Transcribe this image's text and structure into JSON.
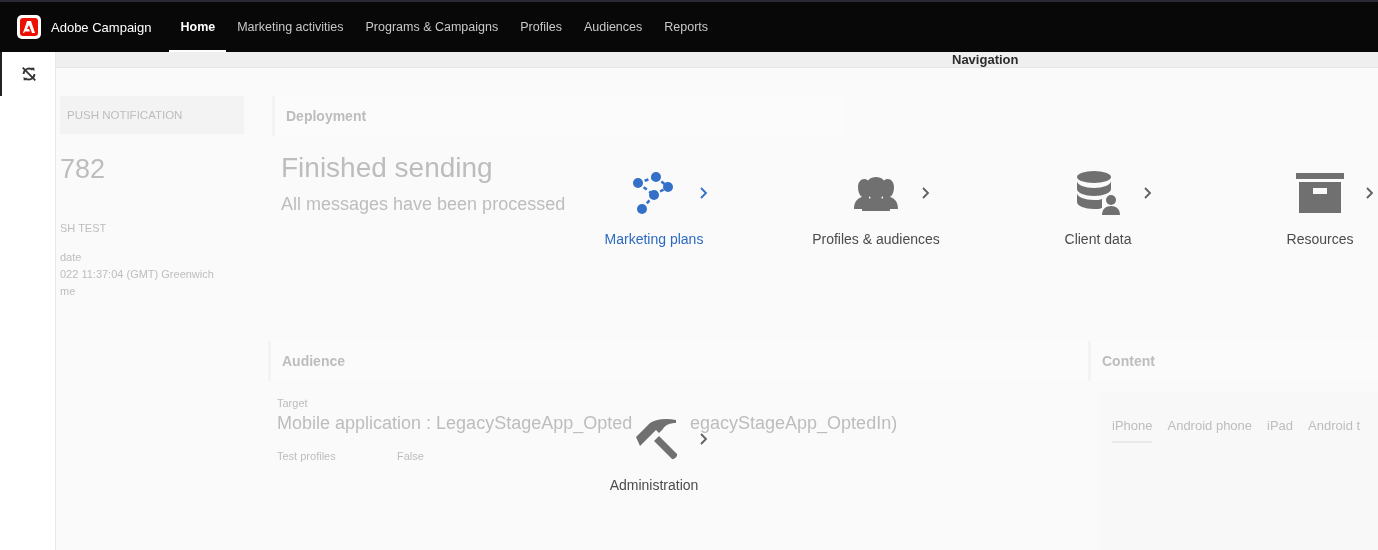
{
  "app": {
    "name": "Adobe Campaign"
  },
  "nav_tabs": [
    {
      "label": "Home",
      "selected": true
    },
    {
      "label": "Marketing activities",
      "selected": false
    },
    {
      "label": "Programs & Campaigns",
      "selected": false
    },
    {
      "label": "Profiles",
      "selected": false
    },
    {
      "label": "Audiences",
      "selected": false
    },
    {
      "label": "Reports",
      "selected": false
    }
  ],
  "background": {
    "left": {
      "badge": "PUSH NOTIFICATION",
      "number": "782",
      "name": "SH TEST",
      "date_label": "date",
      "date_lines": [
        "022 11:37:04 (GMT) Greenwich",
        "me"
      ]
    },
    "deployment": {
      "title": "Deployment",
      "status": "Finished sending",
      "detail": "All messages have been processed"
    },
    "audience": {
      "title": "Audience",
      "target_label": "Target",
      "target": [
        "Mobile application : LegacyStageApp_Opted",
        "egacyStageApp_OptedIn)"
      ],
      "test_label": "Test profiles",
      "test_value": "False"
    },
    "content": {
      "title": "Content",
      "tabs": [
        {
          "label": "iPhone",
          "selected": true
        },
        {
          "label": "Android phone",
          "selected": false
        },
        {
          "label": "iPad",
          "selected": false
        },
        {
          "label": "Android t",
          "selected": false
        }
      ]
    }
  },
  "panel": {
    "title": "Navigation",
    "items": [
      {
        "label": "Marketing plans",
        "kind": "plans",
        "selected": true
      },
      {
        "label": "Profiles & audiences",
        "kind": "profiles",
        "selected": false
      },
      {
        "label": "Client data",
        "kind": "data",
        "selected": false
      },
      {
        "label": "Resources",
        "kind": "resources",
        "selected": false
      },
      {
        "label": "Administration",
        "kind": "admin",
        "selected": false
      }
    ]
  }
}
